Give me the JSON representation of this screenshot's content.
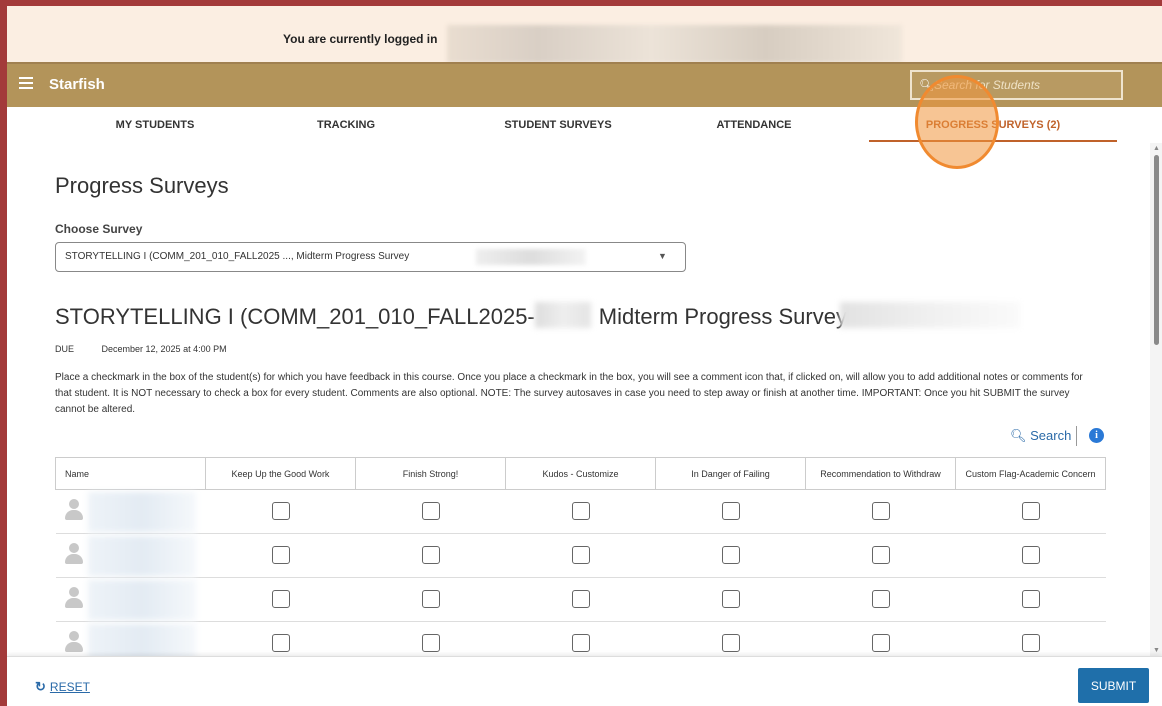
{
  "banner": {
    "login_text": "You are currently logged in"
  },
  "topbar": {
    "brand": "Starfish",
    "search_placeholder": "Search for Students"
  },
  "tabs": [
    {
      "label": "MY STUDENTS"
    },
    {
      "label": "TRACKING"
    },
    {
      "label": "STUDENT SURVEYS"
    },
    {
      "label": "ATTENDANCE"
    },
    {
      "label": "PROGRESS SURVEYS (2)",
      "active": true
    }
  ],
  "page": {
    "title": "Progress Surveys",
    "choose_label": "Choose Survey",
    "selected_survey": "STORYTELLING I (COMM_201_010_FALL2025 ..., Midterm Progress Survey",
    "survey_heading_part1": "STORYTELLING I (COMM_201_010_FALL2025-",
    "survey_heading_part2": "Midterm Progress Survey",
    "due_label": "DUE",
    "due_value": "December 12, 2025 at 4:00 PM",
    "instructions": "Place a checkmark in the box of the student(s) for which you have feedback in this course. Once you place a checkmark in the box, you will see a comment icon that, if clicked on, will allow you to add additional notes or comments for that student. It is NOT necessary to check a box for every student. Comments are also optional. NOTE: The survey autosaves in case you need to step away or finish at another time. IMPORTANT: Once you hit SUBMIT the survey cannot be altered."
  },
  "table_tools": {
    "search_label": "Search",
    "info_icon": "info-icon"
  },
  "table": {
    "columns": [
      "Name",
      "Keep Up the Good Work",
      "Finish Strong!",
      "Kudos - Customize",
      "In Danger of Failing",
      "Recommendation to Withdraw",
      "Custom Flag-Academic Concern"
    ]
  },
  "footer": {
    "reset_label": "RESET",
    "submit_label": "SUBMIT"
  },
  "colors": {
    "brand_bar": "#b3945a",
    "accent": "#c0622a",
    "link": "#2a6aa8",
    "submit": "#1f6faa",
    "frame": "#a33a3a"
  }
}
